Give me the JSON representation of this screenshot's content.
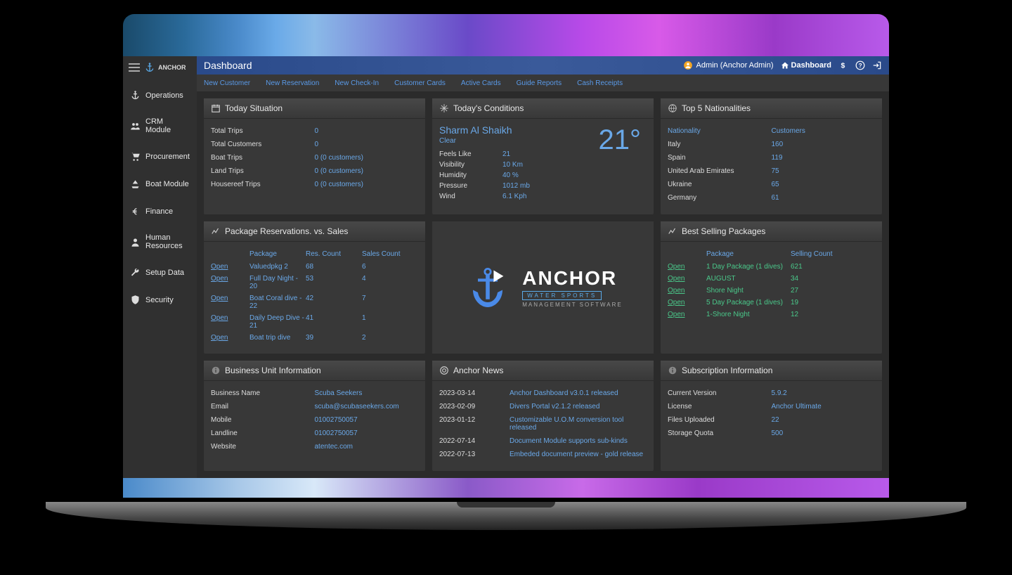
{
  "brand": "ANCHOR",
  "topbar": {
    "title": "Dashboard",
    "user": "Admin (Anchor Admin)",
    "dashboard_link": "Dashboard"
  },
  "sidebar": {
    "items": [
      {
        "label": "Operations",
        "icon": "anchor"
      },
      {
        "label": "CRM Module",
        "icon": "users"
      },
      {
        "label": "Procurement",
        "icon": "cart"
      },
      {
        "label": "Boat Module",
        "icon": "boat"
      },
      {
        "label": "Finance",
        "icon": "euro"
      },
      {
        "label": "Human Resources",
        "icon": "people"
      },
      {
        "label": "Setup Data",
        "icon": "wrench"
      },
      {
        "label": "Security",
        "icon": "shield"
      }
    ]
  },
  "subnav": [
    "New Customer",
    "New Reservation",
    "New Check-In",
    "Customer Cards",
    "Active Cards",
    "Guide Reports",
    "Cash Receipts"
  ],
  "today_situation": {
    "title": "Today Situation",
    "rows": [
      {
        "label": "Total Trips",
        "value": "0"
      },
      {
        "label": "Total Customers",
        "value": "0"
      },
      {
        "label": "Boat Trips",
        "value": "0 (0 customers)"
      },
      {
        "label": "Land Trips",
        "value": "0 (0 customers)"
      },
      {
        "label": "Housereef Trips",
        "value": "0 (0 customers)"
      }
    ]
  },
  "conditions": {
    "title": "Today's Conditions",
    "location": "Sharm Al Shaikh",
    "cond": "Clear",
    "temp": "21°",
    "details": [
      {
        "label": "Feels Like",
        "value": "21"
      },
      {
        "label": "Visibility",
        "value": "10 Km"
      },
      {
        "label": "Humidity",
        "value": "40 %"
      },
      {
        "label": "Pressure",
        "value": "1012 mb"
      },
      {
        "label": "Wind",
        "value": "6.1 Kph"
      }
    ]
  },
  "nationalities": {
    "title": "Top 5 Nationalities",
    "head": {
      "col1": "Nationality",
      "col2": "Customers"
    },
    "rows": [
      {
        "label": "Italy",
        "value": "160"
      },
      {
        "label": "Spain",
        "value": "119"
      },
      {
        "label": "United Arab Emirates",
        "value": "75"
      },
      {
        "label": "Ukraine",
        "value": "65"
      },
      {
        "label": "Germany",
        "value": "61"
      }
    ]
  },
  "reservations": {
    "title": "Package Reservations. vs. Sales",
    "head": [
      "",
      "Package",
      "Res. Count",
      "Sales Count"
    ],
    "rows": [
      {
        "open": "Open",
        "package": "Valuedpkg 2",
        "res": "68",
        "sales": "6"
      },
      {
        "open": "Open",
        "package": "Full Day Night - 20",
        "res": "53",
        "sales": "4"
      },
      {
        "open": "Open",
        "package": "Boat Coral dive - 22",
        "res": "42",
        "sales": "7"
      },
      {
        "open": "Open",
        "package": "Daily Deep Dive - 21",
        "res": "41",
        "sales": "1"
      },
      {
        "open": "Open",
        "package": "Boat trip dive",
        "res": "39",
        "sales": "2"
      }
    ]
  },
  "best_selling": {
    "title": "Best Selling Packages",
    "head": [
      "",
      "Package",
      "Selling Count"
    ],
    "rows": [
      {
        "open": "Open",
        "package": "1 Day Package (1 dives)",
        "count": "621"
      },
      {
        "open": "Open",
        "package": "AUGUST",
        "count": "34"
      },
      {
        "open": "Open",
        "package": "Shore Night",
        "count": "27"
      },
      {
        "open": "Open",
        "package": "5 Day Package (1 dives)",
        "count": "19"
      },
      {
        "open": "Open",
        "package": "1-Shore Night",
        "count": "12"
      }
    ]
  },
  "business": {
    "title": "Business Unit Information",
    "rows": [
      {
        "label": "Business Name",
        "value": "Scuba Seekers"
      },
      {
        "label": "Email",
        "value": "scuba@scubaseekers.com"
      },
      {
        "label": "Mobile",
        "value": "01002750057"
      },
      {
        "label": "Landline",
        "value": "01002750057"
      },
      {
        "label": "Website",
        "value": "atentec.com"
      }
    ]
  },
  "news": {
    "title": "Anchor News",
    "rows": [
      {
        "date": "2023-03-14",
        "text": "Anchor Dashboard v3.0.1 released"
      },
      {
        "date": "2023-02-09",
        "text": "Divers Portal v2.1.2 released"
      },
      {
        "date": "2023-01-12",
        "text": "Customizable U.O.M conversion tool released"
      },
      {
        "date": "2022-07-14",
        "text": "Document Module supports sub-kinds"
      },
      {
        "date": "2022-07-13",
        "text": "Embeded document preview - gold release"
      }
    ]
  },
  "subscription": {
    "title": "Subscription Information",
    "rows": [
      {
        "label": "Current Version",
        "value": "5.9.2"
      },
      {
        "label": "License",
        "value": "Anchor Ultimate"
      },
      {
        "label": "Files Uploaded",
        "value": "22"
      },
      {
        "label": "Storage Quota",
        "value": "500"
      }
    ]
  },
  "logo": {
    "title": "ANCHOR",
    "sub1": "WATER SPORTS",
    "sub2": "MANAGEMENT SOFTWARE"
  }
}
